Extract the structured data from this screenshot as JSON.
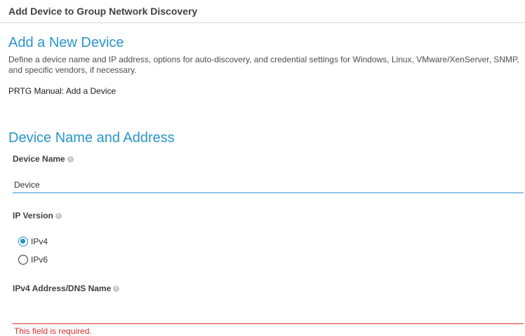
{
  "header": {
    "title": "Add Device to Group Network Discovery"
  },
  "intro": {
    "heading": "Add a New Device",
    "description": "Define a device name and IP address, options for auto-discovery, and credential settings for Windows, Linux, VMware/XenServer, SNMP, and specific vendors, if necessary.",
    "manual_link": "PRTG Manual: Add a Device"
  },
  "section": {
    "heading": "Device Name and Address",
    "device_name": {
      "label": "Device Name",
      "value": "Device"
    },
    "ip_version": {
      "label": "IP Version",
      "options": [
        {
          "label": "IPv4",
          "checked": true
        },
        {
          "label": "IPv6",
          "checked": false
        }
      ]
    },
    "ip_address": {
      "label": "IPv4 Address/DNS Name",
      "value": "",
      "error": "This field is required."
    }
  },
  "icons": {
    "info": "info-icon",
    "info_glyph": "i"
  },
  "colors": {
    "accent": "#2896cb",
    "error": "#d9302b"
  }
}
